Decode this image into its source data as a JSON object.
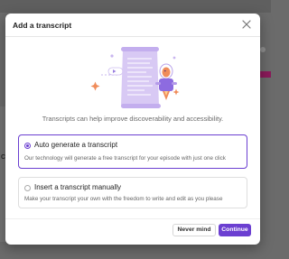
{
  "modal": {
    "title": "Add a transcript",
    "subtitle": "Transcripts can help improve discoverability and accessibility."
  },
  "options": [
    {
      "title": "Auto generate a transcript",
      "description": "Our technology will generate a free transcript for your episode with just one click",
      "selected": true
    },
    {
      "title": "Insert a transcript manually",
      "description": "Make your transcript your own with the freedom to write and edit as you please",
      "selected": false
    }
  ],
  "footer": {
    "cancel_label": "Never mind",
    "continue_label": "Continue"
  },
  "background": {
    "left_text": "Ct"
  },
  "colors": {
    "accent": "#6b3fd1",
    "overlay": "#6b6b6b",
    "illustration_lavender": "#d7c8f3",
    "illustration_orange": "#f08c5a"
  },
  "icons": {
    "close": "close-icon",
    "illustration": "transcript-scroll-rocket-illustration"
  }
}
